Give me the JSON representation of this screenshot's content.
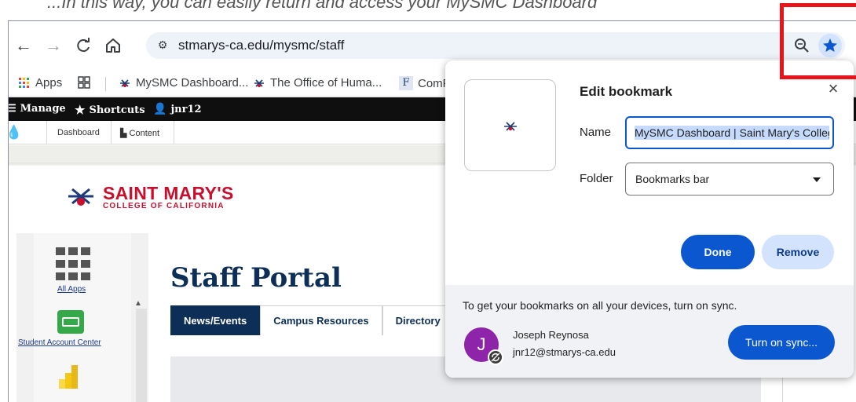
{
  "caption": {
    "text": "...In this way, you can easily return and access your MySMC Dashboard"
  },
  "browser": {
    "url": "stmarys-ca.edu/mysmc/staff",
    "nav_icons": [
      "back-arrow-icon",
      "forward-arrow-icon",
      "reload-icon",
      "home-icon"
    ]
  },
  "bookmarks_bar": {
    "apps_label": "Apps",
    "items": [
      {
        "label": "MySMC Dashboard..."
      },
      {
        "label": "The Office of Huma..."
      },
      {
        "label": "ComF"
      }
    ]
  },
  "admin_toolbar": {
    "manage": "Manage",
    "shortcuts": "Shortcuts",
    "user": "jnr12",
    "sub_items": [
      "Dashboard",
      "Content"
    ]
  },
  "site": {
    "logo_name": "SAINT MARY'S",
    "logo_sub": "COLLEGE OF CALIFORNIA",
    "page_title": "Staff Portal",
    "sidebar": {
      "all_apps": "All Apps",
      "student_account_center": "Student Account Center"
    },
    "tabs": [
      {
        "label": "News/Events",
        "active": true
      },
      {
        "label": "Campus Resources",
        "active": false
      },
      {
        "label": "Directory",
        "active": false
      }
    ]
  },
  "bookmark_dialog": {
    "title": "Edit bookmark",
    "name_label": "Name",
    "name_value": "MySMC Dashboard | Saint Mary's College",
    "folder_label": "Folder",
    "folder_value": "Bookmarks bar",
    "done_label": "Done",
    "remove_label": "Remove",
    "sync_message": "To get your bookmarks on all your devices, turn on sync.",
    "user_initial": "J",
    "user_name": "Joseph Reynosa",
    "user_email": "jnr12@stmarys-ca.edu",
    "sync_button": "Turn on sync..."
  },
  "colors": {
    "accent": "#0b57d0",
    "brand_red": "#c8102e",
    "navy": "#0c2e57",
    "highlight": "#e8141c",
    "avatar": "#8e24aa"
  }
}
